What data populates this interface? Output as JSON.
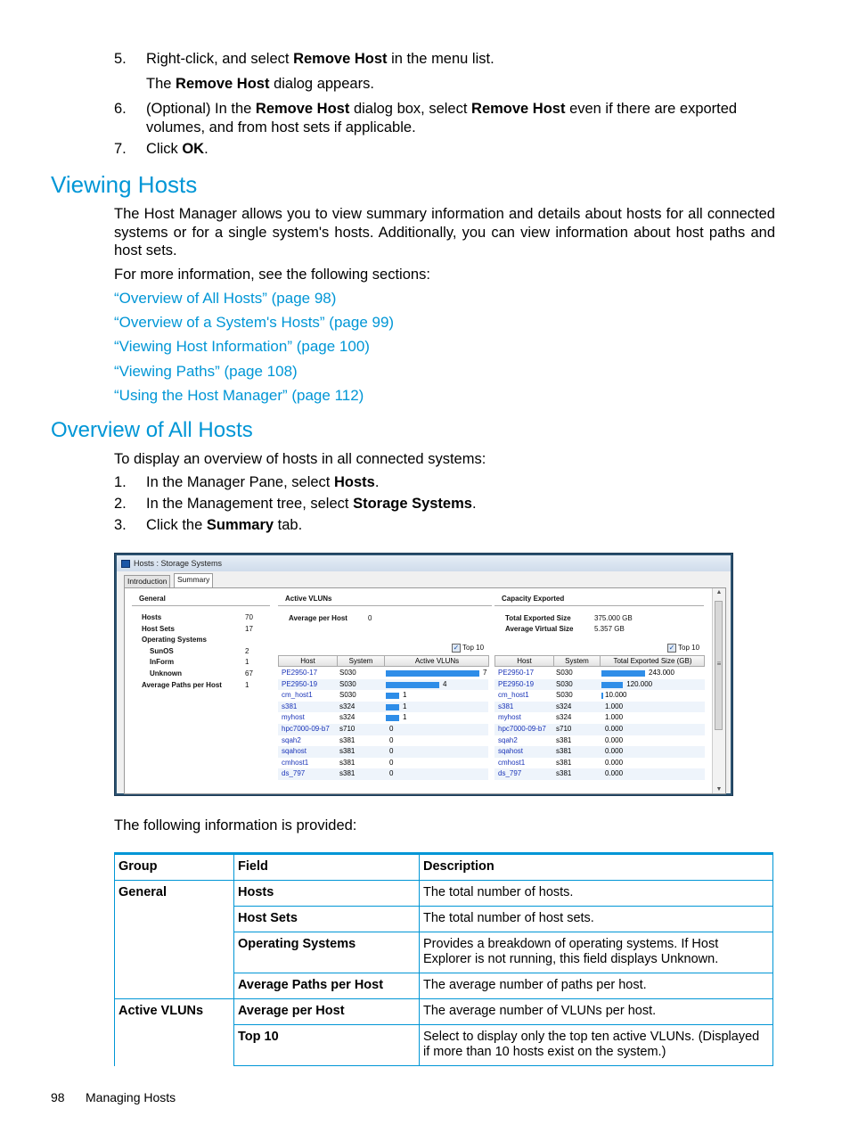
{
  "steps_top": [
    {
      "num": "5.",
      "parts": [
        {
          "t": "Right-click, and select "
        },
        {
          "b": "Remove Host"
        },
        {
          "t": " in the menu list."
        }
      ]
    },
    {
      "num": "",
      "parts": [
        {
          "t": "The "
        },
        {
          "b": "Remove Host"
        },
        {
          "t": " dialog appears."
        }
      ]
    },
    {
      "num": "6.",
      "parts": [
        {
          "t": "(Optional) In the "
        },
        {
          "b": "Remove Host"
        },
        {
          "t": " dialog box, select "
        },
        {
          "b": "Remove Host"
        },
        {
          "t": " even if there are exported volumes, and from host sets if applicable."
        }
      ]
    },
    {
      "num": "7.",
      "parts": [
        {
          "t": "Click "
        },
        {
          "b": "OK"
        },
        {
          "t": "."
        }
      ]
    }
  ],
  "section1": {
    "heading": "Viewing Hosts",
    "intro": "The Host Manager allows you to view summary information and details about hosts for all connected systems or for a single system's hosts. Additionally, you can view information about host paths and host sets.",
    "see_also": "For more information, see the following sections:",
    "links": [
      "“Overview of All Hosts” (page 98)",
      "“Overview of a System's Hosts” (page 99)",
      "“Viewing Host Information” (page 100)",
      "“Viewing Paths” (page 108)",
      "“Using the Host Manager” (page 112)"
    ]
  },
  "section2": {
    "heading": "Overview of All Hosts",
    "intro": "To display an overview of hosts in all connected systems:",
    "steps": [
      {
        "num": "1.",
        "parts": [
          {
            "t": "In the Manager Pane, select "
          },
          {
            "b": "Hosts"
          },
          {
            "t": "."
          }
        ]
      },
      {
        "num": "2.",
        "parts": [
          {
            "t": "In the Management tree, select "
          },
          {
            "b": "Storage Systems"
          },
          {
            "t": "."
          }
        ]
      },
      {
        "num": "3.",
        "parts": [
          {
            "t": "Click the "
          },
          {
            "b": "Summary"
          },
          {
            "t": " tab."
          }
        ]
      }
    ]
  },
  "window": {
    "title": "Hosts : Storage Systems",
    "tabs": [
      "Introduction",
      "Summary"
    ],
    "active_tab": "Summary",
    "general": {
      "title": "General",
      "rows": [
        {
          "label": "Hosts",
          "value": "70",
          "indent": false
        },
        {
          "label": "Host Sets",
          "value": "17",
          "indent": false
        },
        {
          "label": "Operating Systems",
          "value": "",
          "indent": false
        },
        {
          "label": "SunOS",
          "value": "2",
          "indent": true
        },
        {
          "label": "InForm",
          "value": "1",
          "indent": true
        },
        {
          "label": "Unknown",
          "value": "67",
          "indent": true
        },
        {
          "label": "Average Paths per Host",
          "value": "1",
          "indent": false
        }
      ]
    },
    "active_vluns": {
      "title": "Active VLUNs",
      "avg_label": "Average per Host",
      "avg_value": "0",
      "top10_label": "Top 10",
      "top10_checked": true,
      "columns": [
        "Host",
        "System",
        "Active VLUNs"
      ],
      "max": 7,
      "rows": [
        {
          "host": "PE2950-17",
          "system": "S030",
          "value": 7,
          "label": "7"
        },
        {
          "host": "PE2950-19",
          "system": "S030",
          "value": 4,
          "label": "4"
        },
        {
          "host": "cm_host1",
          "system": "S030",
          "value": 1,
          "label": "1"
        },
        {
          "host": "s381",
          "system": "s324",
          "value": 1,
          "label": "1"
        },
        {
          "host": "myhost",
          "system": "s324",
          "value": 1,
          "label": "1"
        },
        {
          "host": "hpc7000-09-b7",
          "system": "s710",
          "value": 0,
          "label": "0"
        },
        {
          "host": "sqah2",
          "system": "s381",
          "value": 0,
          "label": "0"
        },
        {
          "host": "sqahost",
          "system": "s381",
          "value": 0,
          "label": "0"
        },
        {
          "host": "cmhost1",
          "system": "s381",
          "value": 0,
          "label": "0"
        },
        {
          "host": "ds_797",
          "system": "s381",
          "value": 0,
          "label": "0"
        }
      ]
    },
    "capacity": {
      "title": "Capacity Exported",
      "total_label": "Total Exported Size",
      "total_value": "375.000 GB",
      "avg_label": "Average Virtual Size",
      "avg_value": "5.357 GB",
      "top10_label": "Top 10",
      "top10_checked": true,
      "columns": [
        "Host",
        "System",
        "Total Exported Size (GB)"
      ],
      "max": 243,
      "rows": [
        {
          "host": "PE2950-17",
          "system": "S030",
          "value": 243,
          "label": "243.000"
        },
        {
          "host": "PE2950-19",
          "system": "S030",
          "value": 120,
          "label": "120.000"
        },
        {
          "host": "cm_host1",
          "system": "S030",
          "value": 10,
          "label": "10.000"
        },
        {
          "host": "s381",
          "system": "s324",
          "value": 1,
          "label": "1.000"
        },
        {
          "host": "myhost",
          "system": "s324",
          "value": 1,
          "label": "1.000"
        },
        {
          "host": "hpc7000-09-b7",
          "system": "s710",
          "value": 0,
          "label": "0.000"
        },
        {
          "host": "sqah2",
          "system": "s381",
          "value": 0,
          "label": "0.000"
        },
        {
          "host": "sqahost",
          "system": "s381",
          "value": 0,
          "label": "0.000"
        },
        {
          "host": "cmhost1",
          "system": "s381",
          "value": 0,
          "label": "0.000"
        },
        {
          "host": "ds_797",
          "system": "s381",
          "value": 0,
          "label": "0.000"
        }
      ]
    }
  },
  "provided_text": "The following information is provided:",
  "info_table": {
    "headers": [
      "Group",
      "Field",
      "Description"
    ],
    "rows": [
      {
        "group": "General",
        "field": "Hosts",
        "desc": "The total number of hosts."
      },
      {
        "group": "",
        "field": "Host Sets",
        "desc": "The total number of host sets."
      },
      {
        "group": "",
        "field": "Operating Systems",
        "desc": "Provides a breakdown of operating systems. If Host Explorer is not running, this field displays Unknown."
      },
      {
        "group": "",
        "field": "Average Paths per Host",
        "desc": "The average number of paths per host."
      },
      {
        "group": "Active VLUNs",
        "field": "Average per Host",
        "desc": "The average number of VLUNs per host."
      },
      {
        "group": "",
        "field": "Top 10",
        "desc": "Select to display only the top ten active VLUNs. (Displayed if more than 10 hosts exist on the system.)"
      }
    ]
  },
  "footer": {
    "page_number": "98",
    "chapter": "Managing Hosts"
  },
  "colors": {
    "heading": "#0096d6",
    "link": "#0096d6",
    "table_rule": "#0096d6",
    "bar": "#2e8de8",
    "host_link": "#1a34b8"
  }
}
